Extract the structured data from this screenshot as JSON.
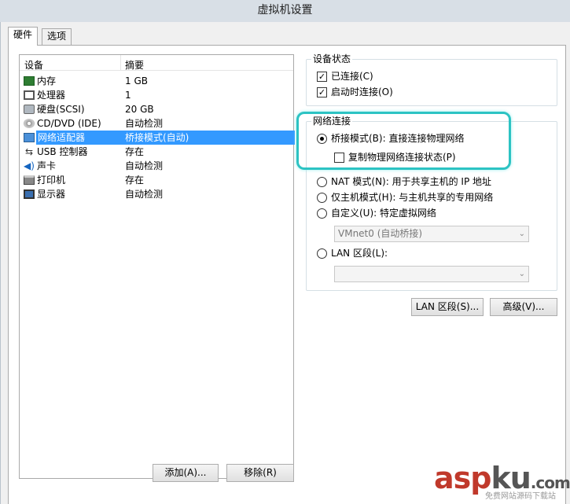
{
  "window": {
    "title": "虚拟机设置"
  },
  "tabs": [
    {
      "label": "硬件"
    },
    {
      "label": "选项"
    }
  ],
  "device_list": {
    "headers": {
      "device": "设备",
      "summary": "摘要"
    },
    "rows": [
      {
        "name": "内存",
        "summary": "1 GB",
        "icon": "memory-icon"
      },
      {
        "name": "处理器",
        "summary": "1",
        "icon": "cpu-icon"
      },
      {
        "name": "硬盘(SCSI)",
        "summary": "20 GB",
        "icon": "hard-disk-icon"
      },
      {
        "name": "CD/DVD (IDE)",
        "summary": "自动检测",
        "icon": "cd-dvd-icon"
      },
      {
        "name": "网络适配器",
        "summary": "桥接模式(自动)",
        "icon": "network-adapter-icon"
      },
      {
        "name": "USB 控制器",
        "summary": "存在",
        "icon": "usb-icon"
      },
      {
        "name": "声卡",
        "summary": "自动检测",
        "icon": "sound-card-icon"
      },
      {
        "name": "打印机",
        "summary": "存在",
        "icon": "printer-icon"
      },
      {
        "name": "显示器",
        "summary": "自动检测",
        "icon": "display-icon"
      }
    ],
    "selected_index": 4
  },
  "device_status": {
    "title": "设备状态",
    "connected": "已连接(C)",
    "connect_at_power_on": "启动时连接(O)"
  },
  "network_connection": {
    "title": "网络连接",
    "bridged": "桥接模式(B): 直接连接物理网络",
    "replicate": "复制物理网络连接状态(P)",
    "nat": "NAT 模式(N): 用于共享主机的 IP 地址",
    "host_only": "仅主机模式(H): 与主机共享的专用网络",
    "custom": "自定义(U): 特定虚拟网络",
    "custom_select": "VMnet0 (自动桥接)",
    "lan_segment": "LAN 区段(L):",
    "lan_select": ""
  },
  "buttons": {
    "lan_segments": "LAN 区段(S)...",
    "advanced": "高级(V)...",
    "add": "添加(A)...",
    "remove": "移除(R)"
  },
  "watermark": {
    "asp": "asp",
    "ku": "ku",
    "domain": ".com",
    "sub": "免费网站源码下载站"
  },
  "colors": {
    "selection": "#3399ff",
    "highlight": "#2cc3c3",
    "watermark": "#c0392b"
  }
}
